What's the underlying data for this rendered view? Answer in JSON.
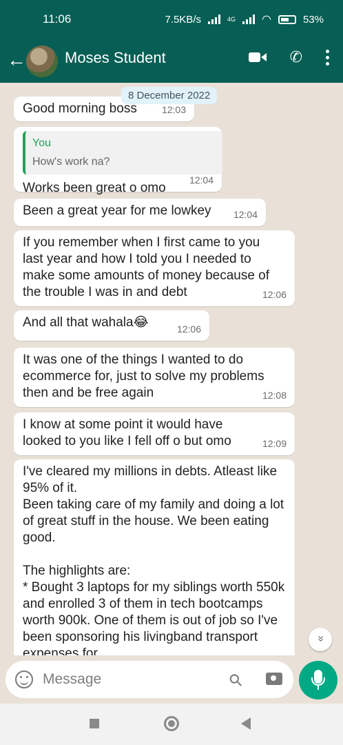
{
  "status": {
    "time": "11:06",
    "network_speed": "7.5KB/s",
    "network_type": "4G",
    "battery": "53"
  },
  "header": {
    "back": "←",
    "contact_name": "Moses Student"
  },
  "chat": {
    "date_chip": "8 December 2022",
    "messages": [
      {
        "text": "Good morning boss",
        "time": "12:03"
      },
      {
        "quote_author": "You",
        "quote_text": "How's work na?",
        "text": "Works been great o omo",
        "time": "12:04"
      },
      {
        "text": "Been a great year for me lowkey",
        "time": "12:04"
      },
      {
        "text": "If you remember when I first came to you last year and how I told you I needed to make some amounts of money because of the trouble I was in and debt",
        "time": "12:06"
      },
      {
        "text": "And all that wahala😂",
        "time": "12:06"
      },
      {
        "text": "It was one of  the things I wanted to do ecommerce for, just to solve my problems then and be free again",
        "time": "12:08"
      },
      {
        "text": "I know at some point it would have looked to you like I fell off o but omo",
        "time": "12:09"
      },
      {
        "text": "I've cleared my millions in debts. Atleast like 95% of it.\nBeen taking care of my family and doing a lot of great stuff in the house. We been eating good.\n\nThe highlights are:\n* Bought 3 laptops for my siblings worth 550k and enrolled 3 of them in tech bootcamps worth 900k. One  of them is out of job so I've been sponsoring his livingband transport expenses for"
      }
    ]
  },
  "composer": {
    "placeholder": "Message",
    "scroll_down": "»"
  },
  "colors": {
    "header": "#075e54",
    "accent": "#00a884",
    "wallpaper": "#e9e1d8",
    "quote_bar": "#25a05a"
  }
}
